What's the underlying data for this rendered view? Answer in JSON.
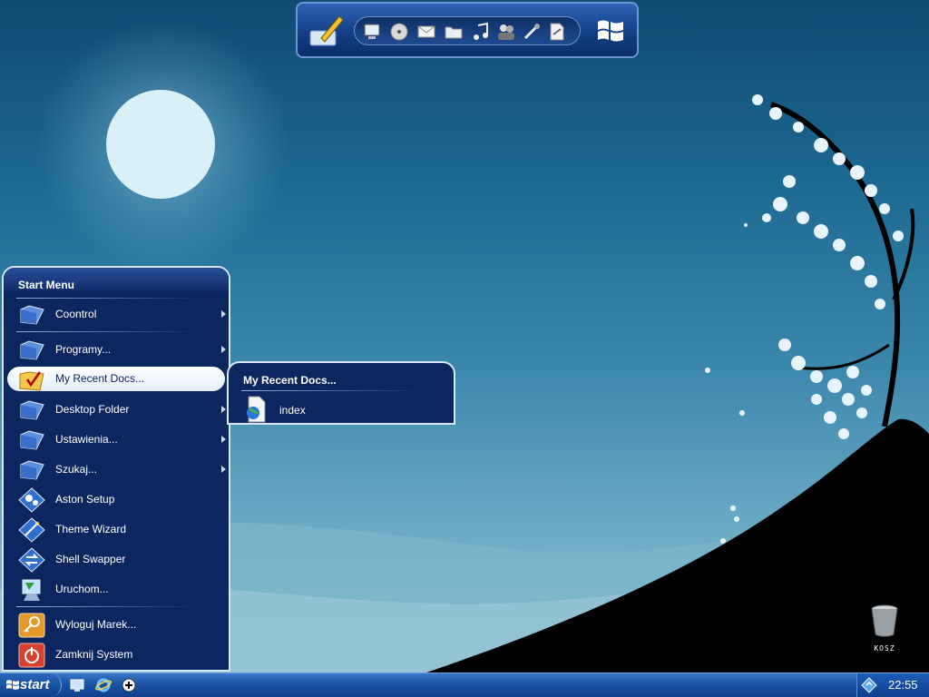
{
  "start_menu": {
    "header": "Start Menu",
    "items": [
      {
        "label": "Coontrol",
        "has_submenu": true,
        "icon": "folder-icon"
      },
      {
        "label": "Programy...",
        "has_submenu": true,
        "icon": "folder-icon"
      },
      {
        "label": "My Recent Docs...",
        "has_submenu": true,
        "icon": "recent-docs-folder-icon",
        "selected": true
      },
      {
        "label": "Desktop Folder",
        "has_submenu": true,
        "icon": "folder-icon"
      },
      {
        "label": "Ustawienia...",
        "has_submenu": true,
        "icon": "folder-icon"
      },
      {
        "label": "Szukaj...",
        "has_submenu": true,
        "icon": "folder-icon"
      },
      {
        "label": "Aston Setup",
        "has_submenu": false,
        "icon": "gears-icon"
      },
      {
        "label": "Theme Wizard",
        "has_submenu": false,
        "icon": "wizard-icon"
      },
      {
        "label": "Shell Swapper",
        "has_submenu": false,
        "icon": "swap-icon"
      },
      {
        "label": "Uruchom...",
        "has_submenu": false,
        "icon": "run-icon"
      },
      {
        "label": "Wyloguj Marek...",
        "has_submenu": false,
        "icon": "key-icon"
      },
      {
        "label": "Zamknij System",
        "has_submenu": false,
        "icon": "power-icon"
      }
    ]
  },
  "submenu": {
    "header": "My Recent Docs...",
    "items": [
      {
        "label": "index",
        "icon": "html-document-icon"
      }
    ]
  },
  "dock": {
    "icons": [
      "computer-icon",
      "cd-icon",
      "mail-icon",
      "folder-icon",
      "music-icon",
      "users-icon",
      "tools-icon",
      "document-icon"
    ]
  },
  "desktop": {
    "recycle_bin_label": "KOSZ"
  },
  "taskbar": {
    "start_label": "start",
    "clock": "22:55",
    "quick_launch": [
      "desktop-icon",
      "internet-explorer-icon",
      "add-icon"
    ]
  },
  "colors": {
    "menu_bg": "#0c2660",
    "taskbar": "#1d56a8",
    "selection": "#ffffff"
  }
}
